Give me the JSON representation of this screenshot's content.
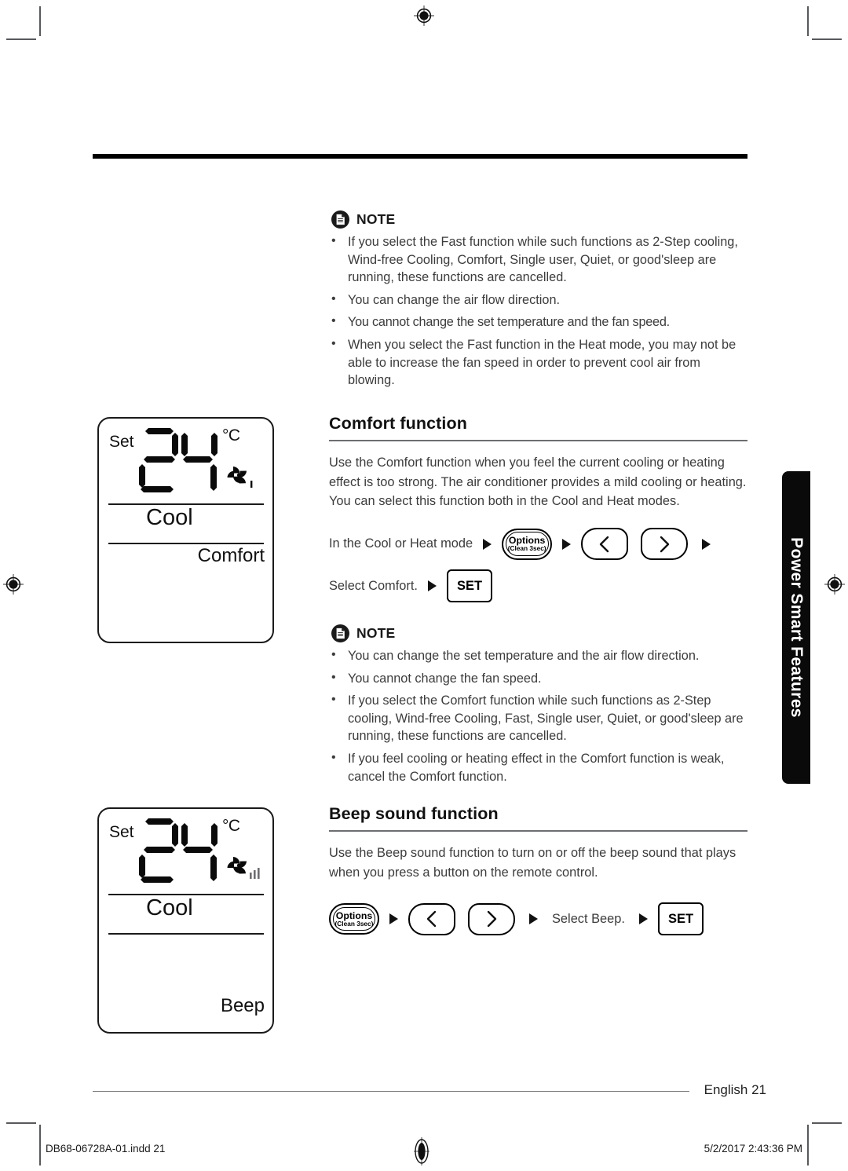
{
  "page": {
    "header_rule": true,
    "page_footer_label": "English  21",
    "file_meta_left": "DB68-06728A-01.indd   21",
    "file_meta_right": "5/2/2017   2:43:36 PM"
  },
  "side_tab": {
    "label": "Power Smart Features",
    "background": "#0a0a0a",
    "text_color": "#ffffff"
  },
  "notes": [
    {
      "icon": "document-note-icon",
      "label": "NOTE",
      "items": [
        "If you select the Fast function while such functions as 2-Step cooling, Wind-free Cooling, Comfort, Single user, Quiet, or good'sleep are running, these functions are cancelled.",
        "You can change the air flow direction.",
        "You cannot change the set temperature and the fan speed.",
        "When you select the Fast function in the Heat mode, you may not be able to increase the fan speed in order to prevent cool air from blowing."
      ]
    },
    {
      "icon": "document-note-icon",
      "label": "NOTE",
      "items": [
        "You can change the set temperature and the air flow direction.",
        "You cannot change the fan speed.",
        "If you select the Comfort function while such functions as 2-Step cooling, Wind-free Cooling, Fast, Single user, Quiet, or good'sleep are running, these functions are cancelled.",
        "If you feel cooling or heating effect in the Comfort function is weak, cancel the Comfort function."
      ]
    }
  ],
  "sections": [
    {
      "title": "Comfort function",
      "body": "Use the Comfort function when you feel the current cooling or heating effect is too strong. The air conditioner provides a mild cooling or heating. You can select this function both in the Cool and Heat modes.",
      "steps": [
        {
          "lead_text": "In the Cool or Heat mode",
          "options_label": "Options",
          "options_sub": "(Clean 3sec)",
          "nav_left": "‹",
          "nav_right": "›",
          "trailing_arrow": true
        },
        {
          "lead_text": "Select Comfort.",
          "set_label": "SET"
        }
      ]
    },
    {
      "title": "Beep sound function",
      "body": "Use the Beep sound function to turn on or off the beep sound that plays when you press a button on the remote control.",
      "steps": [
        {
          "options_label": "Options",
          "options_sub": "(Clean 3sec)",
          "nav_left": "‹",
          "nav_right": "›",
          "mid_text": "Select Beep.",
          "set_label": "SET"
        }
      ]
    }
  ],
  "displays": [
    {
      "name": "comfort-display",
      "set_label": "Set",
      "temperature": "24",
      "unit": "°C",
      "mode": "Cool",
      "status": "Comfort",
      "fan_bars": 1
    },
    {
      "name": "beep-display",
      "set_label": "Set",
      "temperature": "24",
      "unit": "°C",
      "mode": "Cool",
      "status": "Beep",
      "fan_bars": 3
    }
  ]
}
